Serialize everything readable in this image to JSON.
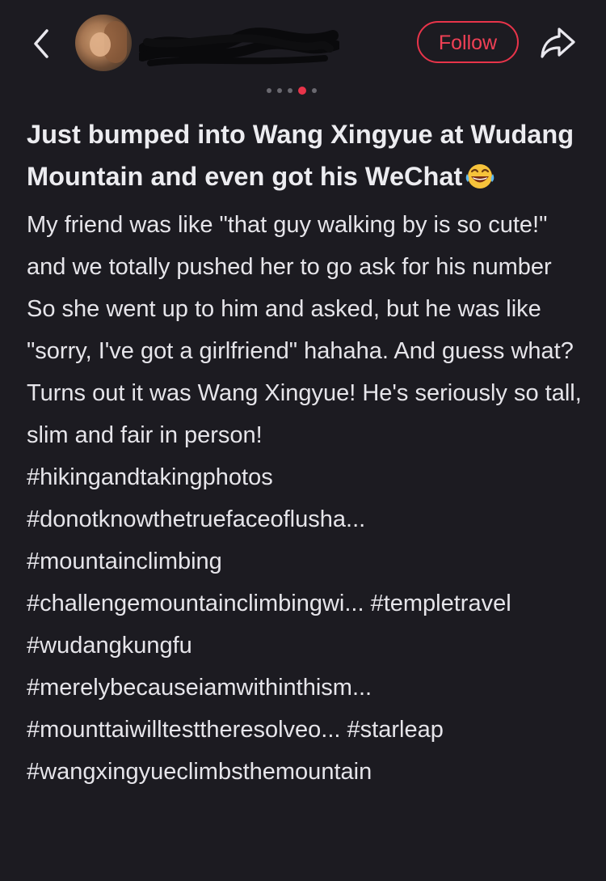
{
  "header": {
    "follow_label": "Follow"
  },
  "carousel": {
    "count": 5,
    "active_index": 3
  },
  "post": {
    "title": "Just bumped into Wang Xingyue at Wudang Mountain and even got his WeChat",
    "title_emoji": "face-with-tears-of-joy",
    "paragraphs": [
      "My friend was like \"that guy walking by is so cute!\" and we totally pushed her to go ask for his number",
      "So she went up to him and asked, but he was like \"sorry, I've got a girlfriend\" hahaha. And guess what? Turns out it was Wang Xingyue! He's seriously so tall, slim and fair in person!"
    ],
    "hashtags": [
      "#hikingandtakingphotos",
      "#donotknowthetruefaceoflusha...",
      "#mountainclimbing",
      "#challengemountainclimbingwi...",
      "#templetravel",
      "#wudangkungfu",
      "#merelybecauseiamwithinthism...",
      "#mounttaiwilltesttheresolveo...",
      "#starleap",
      "#wangxingyueclimbsthemountain"
    ]
  },
  "colors": {
    "accent": "#e8344a",
    "background": "#1c1b21",
    "text": "#e6e5ea"
  },
  "icons": [
    "back-arrow-icon",
    "share-icon",
    "laughing-emoji-icon"
  ]
}
